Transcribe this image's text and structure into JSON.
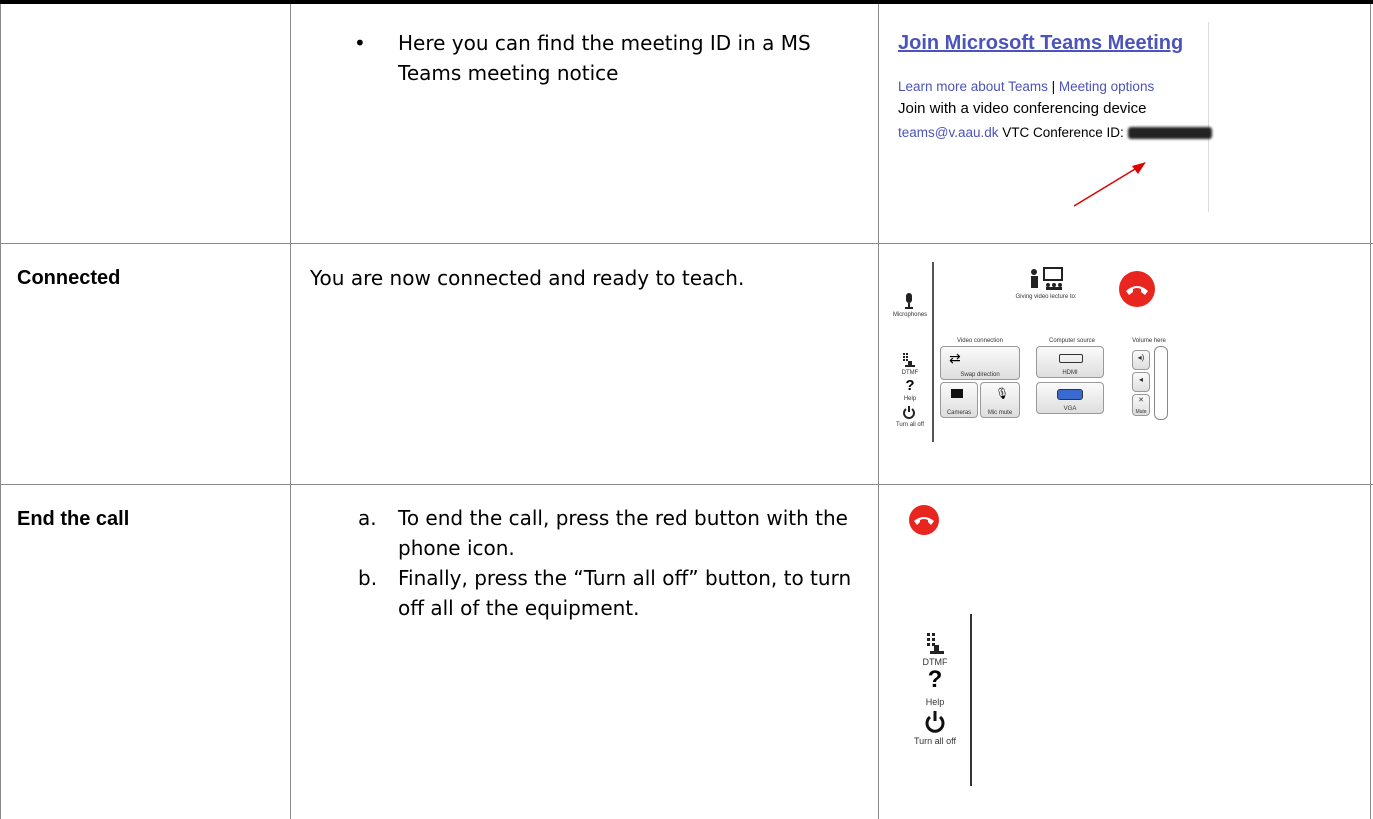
{
  "rows": [
    {
      "label": "",
      "bullet": "Here you can find the meeting ID in a MS Teams meeting notice",
      "notice": {
        "title": "Join Microsoft Teams Meeting",
        "link1": "Learn more about Teams",
        "separator": "|",
        "link2": "Meeting options",
        "line2": "Join with a video conferencing device",
        "email": "teams@v.aau.dk",
        "conf_label": "VTC Conference ID:"
      }
    },
    {
      "label": "Connected",
      "text": "You are now connected and ready to teach.",
      "panel": {
        "microphones": "Microphones",
        "giving": "Giving video lecture to:",
        "video_connection": "Video connection",
        "computer_source": "Computer source",
        "volume_here": "Volume here",
        "swap": "Swap direction",
        "hdmi": "HDMI",
        "vga": "VGA",
        "cameras": "Cameras",
        "mic_mute": "Mic mute",
        "mute": "Mute",
        "dtmf": "DTMF",
        "help": "Help",
        "turn_all_off": "Turn all off"
      }
    },
    {
      "label": "End the call",
      "step_a_marker": "a.",
      "step_a": "To end the call, press the red button with the phone icon.",
      "step_b_marker": "b.",
      "step_b": "Finally, press the “Turn all off” button, to turn off all of the equipment.",
      "side": {
        "dtmf": "DTMF",
        "help": "Help",
        "turn_all_off": "Turn all off"
      }
    }
  ]
}
